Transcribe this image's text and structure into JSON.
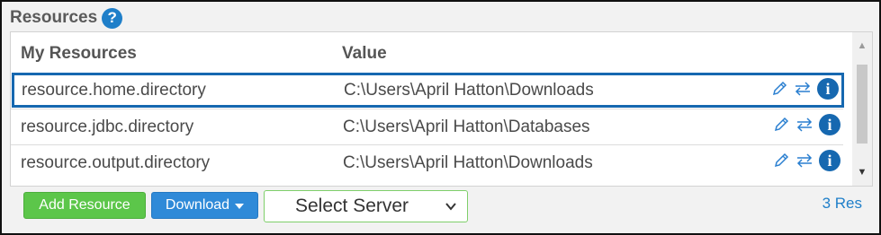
{
  "panel": {
    "title": "Resources",
    "help_icon": "question-circle-icon"
  },
  "table": {
    "columns": [
      "My Resources",
      "Value"
    ],
    "rows": [
      {
        "name": "resource.home.directory",
        "value": "C:\\Users\\April Hatton\\Downloads",
        "selected": true
      },
      {
        "name": "resource.jdbc.directory",
        "value": "C:\\Users\\April Hatton\\Databases",
        "selected": false
      },
      {
        "name": "resource.output.directory",
        "value": "C:\\Users\\April Hatton\\Downloads",
        "selected": false
      }
    ],
    "row_actions": [
      "pencil-icon",
      "swap-icon",
      "info-icon"
    ],
    "info_glyph": "i"
  },
  "footer": {
    "add_label": "Add Resource",
    "download_label": "Download",
    "server_select": {
      "selected": "Select Server"
    },
    "count_text": "3 Res"
  },
  "colors": {
    "accent": "#1668b0",
    "add_button": "#5cc64a",
    "download_button": "#2f8ad8",
    "count_text": "#1f7fc9"
  }
}
